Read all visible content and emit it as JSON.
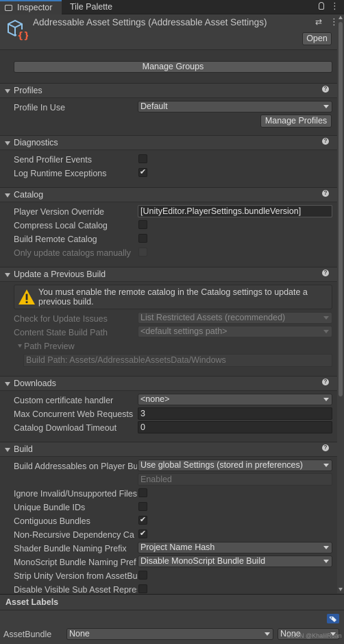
{
  "tabs": {
    "inspector": "Inspector",
    "tile_palette": "Tile Palette"
  },
  "header": {
    "title": "Addressable Asset Settings (Addressable Asset Settings)",
    "open_label": "Open"
  },
  "manage_groups": "Manage Groups",
  "profiles": {
    "title": "Profiles",
    "profile_in_use_label": "Profile In Use",
    "profile_value": "Default",
    "manage_profiles": "Manage Profiles"
  },
  "diagnostics": {
    "title": "Diagnostics",
    "send_profiler_events": "Send Profiler Events",
    "send_profiler_events_checked": false,
    "log_runtime_exceptions": "Log Runtime Exceptions",
    "log_runtime_exceptions_checked": true
  },
  "catalog": {
    "title": "Catalog",
    "player_version_override": "Player Version Override",
    "player_version_value": "[UnityEditor.PlayerSettings.bundleVersion]",
    "compress_local_catalog": "Compress Local Catalog",
    "build_remote_catalog": "Build Remote Catalog",
    "only_update_manually": "Only update catalogs manually"
  },
  "update_build": {
    "title": "Update a Previous Build",
    "warning": "You must enable the remote catalog in the Catalog settings to update a previous build.",
    "check_issues_label": "Check for Update Issues",
    "check_issues_value": "List Restricted Assets (recommended)",
    "content_state_label": "Content State Build Path",
    "content_state_value": "<default settings path>",
    "path_preview": "Path Preview",
    "build_path": "Build Path: Assets/AddressableAssetsData/Windows"
  },
  "downloads": {
    "title": "Downloads",
    "cert_handler_label": "Custom certificate handler",
    "cert_handler_value": "<none>",
    "max_requests_label": "Max Concurrent Web Requests",
    "max_requests_value": "3",
    "timeout_label": "Catalog Download Timeout",
    "timeout_value": "0"
  },
  "build": {
    "title": "Build",
    "build_on_player_label": "Build Addressables on Player Bu",
    "build_on_player_value": "Use global Settings (stored in preferences)",
    "enabled_value": "Enabled",
    "ignore_invalid": "Ignore Invalid/Unsupported Files",
    "ignore_invalid_checked": false,
    "unique_ids": "Unique Bundle IDs",
    "unique_ids_checked": false,
    "contiguous": "Contiguous Bundles",
    "contiguous_checked": true,
    "non_recursive": "Non-Recursive Dependency Ca",
    "non_recursive_checked": true,
    "shader_prefix_label": "Shader Bundle Naming Prefix",
    "shader_prefix_value": "Project Name Hash",
    "monoscript_label": "MonoScript Bundle Naming Pref",
    "monoscript_value": "Disable MonoScript Bundle Build",
    "strip_unity": "Strip Unity Version from AssetBu",
    "strip_unity_checked": false,
    "disable_visible": "Disable Visible Sub Asset Repres",
    "disable_visible_checked": false
  },
  "asset_labels": {
    "title": "Asset Labels",
    "assetbundle_label": "AssetBundle",
    "bundle_value": "None",
    "variant_value": "None",
    "watermark": "CSDN @KhalilRuan"
  }
}
